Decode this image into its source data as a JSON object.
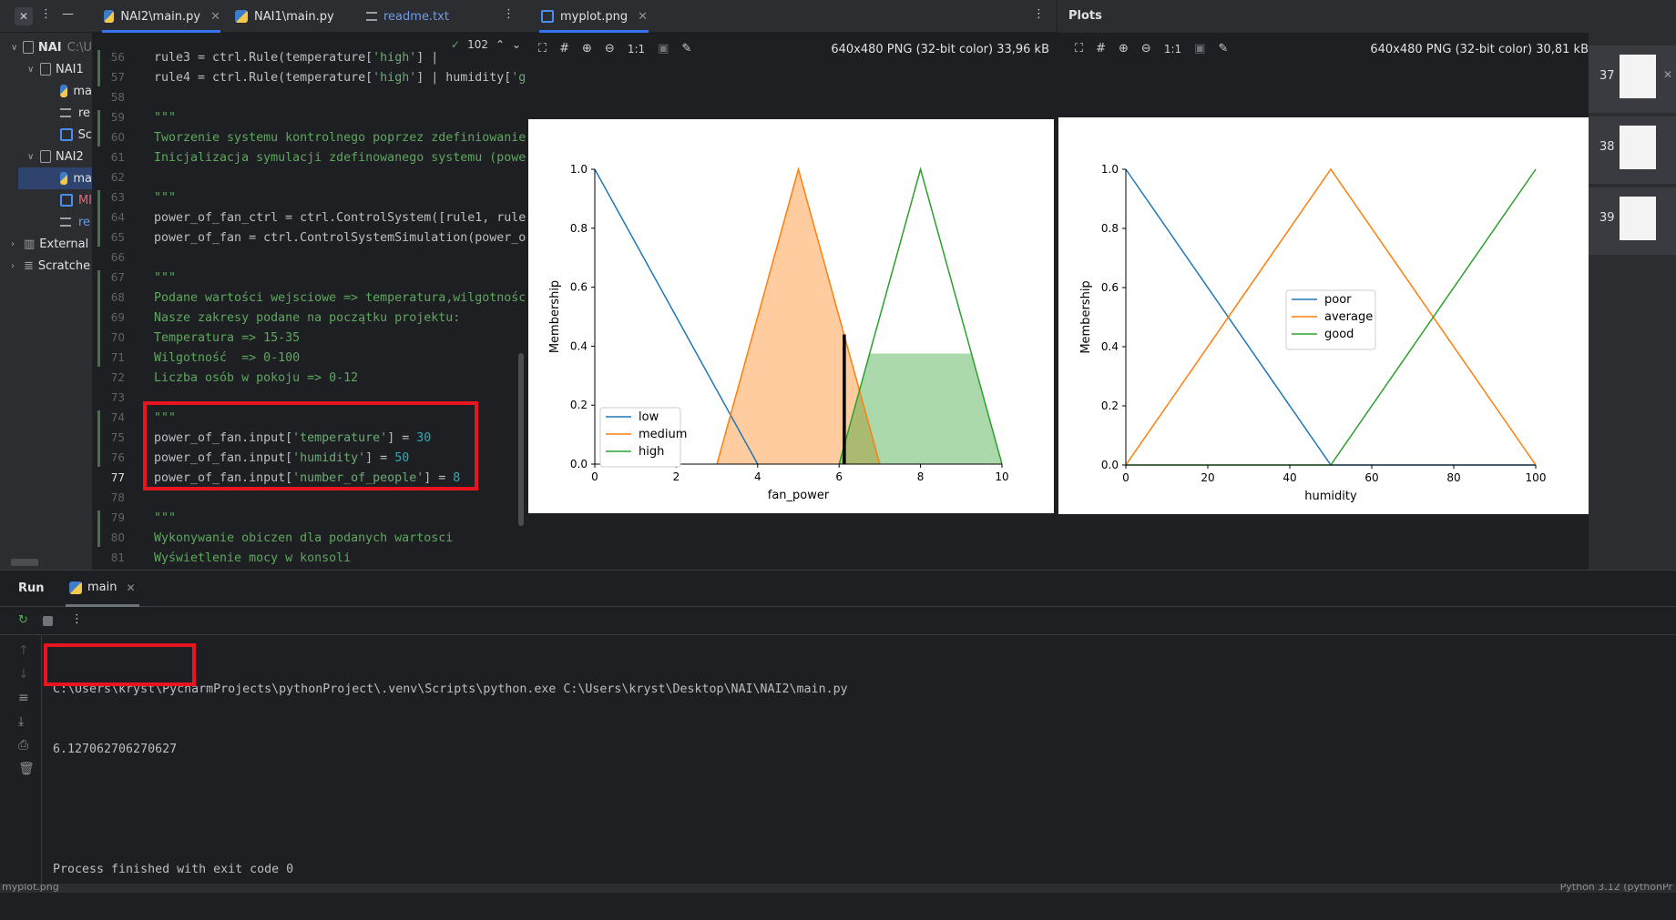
{
  "editor_tabs": [
    {
      "label": "NAI2\\main.py",
      "active": true
    },
    {
      "label": "NAI1\\main.py",
      "active": false
    },
    {
      "label": "readme.txt",
      "active": false
    }
  ],
  "viewer_tab": {
    "label": "myplot.png"
  },
  "plots_title": "Plots",
  "project_tree": [
    {
      "label": "NAI",
      "suffix": "C:\\U",
      "level": 0,
      "expanded": true
    },
    {
      "label": "NAI1",
      "level": 1,
      "expanded": true
    },
    {
      "label": "ma",
      "level": 2
    },
    {
      "label": "re",
      "level": 2
    },
    {
      "label": "Sc",
      "level": 2
    },
    {
      "label": "NAI2",
      "level": 1,
      "expanded": true
    },
    {
      "label": "ma",
      "level": 2,
      "selected": true
    },
    {
      "label": "MI",
      "level": 2
    },
    {
      "label": "re",
      "level": 2
    },
    {
      "label": "External",
      "level": 0
    },
    {
      "label": "Scratche",
      "level": 0
    }
  ],
  "editor": {
    "hint_count": "102",
    "lines": [
      {
        "n": "56",
        "text": "rule3 = ctrl.Rule(temperature['high'] | "
      },
      {
        "n": "57",
        "text": "rule4 = ctrl.Rule(temperature['high'] | humidity['g"
      },
      {
        "n": "58",
        "text": ""
      },
      {
        "n": "59",
        "text": "\"\"\""
      },
      {
        "n": "60",
        "text": "Tworzenie systemu kontrolnego poprzez zdefiniowanie"
      },
      {
        "n": "61",
        "text": "Inicjalizacja symulacji zdefinowanego systemu (powe"
      },
      {
        "n": "62",
        "text": ""
      },
      {
        "n": "63",
        "text": "\"\"\""
      },
      {
        "n": "64",
        "text": "power_of_fan_ctrl = ctrl.ControlSystem([rule1, rule"
      },
      {
        "n": "65",
        "text": "power_of_fan = ctrl.ControlSystemSimulation(power_o"
      },
      {
        "n": "66",
        "text": ""
      },
      {
        "n": "67",
        "text": "\"\"\""
      },
      {
        "n": "68",
        "text": "Podane wartości wejsciowe => temperatura,wilgotnośc"
      },
      {
        "n": "69",
        "text": "Nasze zakresy podane na początku projektu:"
      },
      {
        "n": "70",
        "text": "Temperatura => 15-35"
      },
      {
        "n": "71",
        "text": "Wilgotność  => 0-100"
      },
      {
        "n": "72",
        "text": "Liczba osób w pokoju => 0-12"
      },
      {
        "n": "73",
        "text": ""
      },
      {
        "n": "74",
        "text": "\"\"\""
      },
      {
        "n": "75",
        "text": "power_of_fan.input['temperature'] = 30"
      },
      {
        "n": "76",
        "text": "power_of_fan.input['humidity'] = 50"
      },
      {
        "n": "77",
        "text": "power_of_fan.input['number_of_people'] = 8"
      },
      {
        "n": "78",
        "text": ""
      },
      {
        "n": "79",
        "text": "\"\"\""
      },
      {
        "n": "80",
        "text": "Wykonywanie obiczen dla podanych wartosci"
      },
      {
        "n": "81",
        "text": "Wyświetlenie mocy w konsoli"
      }
    ]
  },
  "viewer": {
    "info": "640x480 PNG (32-bit color) 33,96 kB",
    "zoom_label": "1:1"
  },
  "plots_panel": {
    "info": "640x480 PNG (32-bit color) 30,81 kB",
    "zoom_label": "1:1",
    "thumbnails": [
      "37",
      "38",
      "39"
    ]
  },
  "chart_data": [
    {
      "type": "line",
      "xlabel": "fan_power",
      "ylabel": "Membership",
      "xlim": [
        0,
        10
      ],
      "ylim": [
        0,
        1
      ],
      "xticks": [
        "0",
        "2",
        "4",
        "6",
        "8",
        "10"
      ],
      "yticks": [
        "0.0",
        "0.2",
        "0.4",
        "0.6",
        "0.8",
        "1.0"
      ],
      "legend_position": "bottom-left",
      "series": [
        {
          "name": "low",
          "color": "#1f77b4",
          "x": [
            0,
            4
          ],
          "y": [
            1,
            0
          ]
        },
        {
          "name": "medium",
          "color": "#ff7f0e",
          "x": [
            3,
            5,
            7
          ],
          "y": [
            0,
            1,
            0
          ]
        },
        {
          "name": "high",
          "color": "#2ca02c",
          "x": [
            6,
            8,
            10
          ],
          "y": [
            0,
            1,
            0
          ]
        }
      ],
      "filled_regions": [
        {
          "series": "medium",
          "color": "#ff7f0e",
          "x": [
            3,
            5,
            7
          ],
          "y": [
            0,
            1,
            0
          ]
        },
        {
          "series": "high",
          "color": "#2ca02c",
          "x": [
            6,
            6.75,
            9.25,
            10
          ],
          "y": [
            0,
            0.375,
            0.375,
            0
          ]
        }
      ],
      "result_line": {
        "x": 6.127,
        "y": 0.44
      }
    },
    {
      "type": "line",
      "xlabel": "humidity",
      "ylabel": "Membership",
      "xlim": [
        0,
        100
      ],
      "ylim": [
        0,
        1
      ],
      "xticks": [
        "0",
        "20",
        "40",
        "60",
        "80",
        "100"
      ],
      "yticks": [
        "0.0",
        "0.2",
        "0.4",
        "0.6",
        "0.8",
        "1.0"
      ],
      "legend_position": "center",
      "series": [
        {
          "name": "poor",
          "color": "#1f77b4",
          "x": [
            0,
            50,
            100
          ],
          "y": [
            1,
            0,
            0
          ]
        },
        {
          "name": "average",
          "color": "#ff7f0e",
          "x": [
            0,
            50,
            100
          ],
          "y": [
            0,
            1,
            0
          ]
        },
        {
          "name": "good",
          "color": "#2ca02c",
          "x": [
            0,
            50,
            100
          ],
          "y": [
            0,
            0,
            1
          ]
        }
      ]
    }
  ],
  "run": {
    "title": "Run",
    "tab": "main",
    "command": "C:\\Users\\kryst\\PycharmProjects\\pythonProject\\.venv\\Scripts\\python.exe C:\\Users\\kryst\\Desktop\\NAI\\NAI2\\main.py",
    "result": "6.127062706270627",
    "finished": "Process finished with exit code 0"
  },
  "status_bar": {
    "left": "myplot.png",
    "right": "Python 3.12 (pythonPr"
  }
}
